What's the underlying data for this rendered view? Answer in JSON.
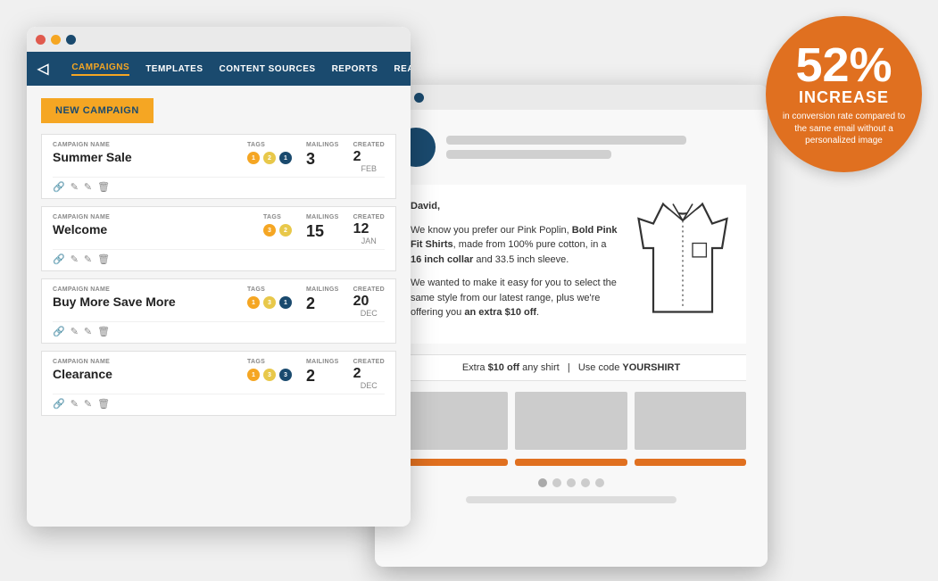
{
  "badge": {
    "percent": "52%",
    "increase": "INCREASE",
    "description": "in conversion rate compared to the same email without a personalized image"
  },
  "left_window": {
    "nav": {
      "items": [
        "CAMPAIGNS",
        "TEMPLATES",
        "CONTENT SOURCES",
        "REPORTS",
        "REAL TIME"
      ],
      "active": "CAMPAIGNS"
    },
    "new_campaign_btn": "NEW CAMPAIGN",
    "campaigns": [
      {
        "name": "Summer Sale",
        "tags": [
          {
            "color": "orange",
            "count": "1"
          },
          {
            "color": "yellow",
            "count": "2"
          },
          {
            "color": "dark",
            "count": "1"
          }
        ],
        "mailings": "3",
        "created_day": "2",
        "created_month": "FEB"
      },
      {
        "name": "Welcome",
        "tags": [
          {
            "color": "orange",
            "count": "3"
          },
          {
            "color": "yellow",
            "count": "2"
          }
        ],
        "mailings": "15",
        "created_day": "12",
        "created_month": "JAN"
      },
      {
        "name": "Buy More Save More",
        "tags": [
          {
            "color": "orange",
            "count": "1"
          },
          {
            "color": "yellow",
            "count": "3"
          },
          {
            "color": "dark",
            "count": "1"
          }
        ],
        "mailings": "2",
        "created_day": "20",
        "created_month": "DEC"
      },
      {
        "name": "Clearance",
        "tags": [
          {
            "color": "orange",
            "count": "1"
          },
          {
            "color": "yellow",
            "count": "3"
          },
          {
            "color": "dark",
            "count": "3"
          }
        ],
        "mailings": "2",
        "created_day": "2",
        "created_month": "DEC"
      }
    ],
    "col_labels": {
      "campaign_name": "CAMPAIGN NAME",
      "tags": "TAGS",
      "mailings": "MAILINGS",
      "created": "CREATED"
    }
  },
  "right_window": {
    "greeting": "David,",
    "body_p1": "We know you prefer our Pink Poplin, Bold Pink Fit Shirts, made from 100% pure cotton, in a 16 inch collar and 33.5 inch sleeve.",
    "body_p2": "We wanted to make it easy for you to select the same style from our latest range, plus we're offering you an extra $10 off.",
    "promo": "Extra $10 off any shirt  |  Use code YOURSHIRT"
  }
}
